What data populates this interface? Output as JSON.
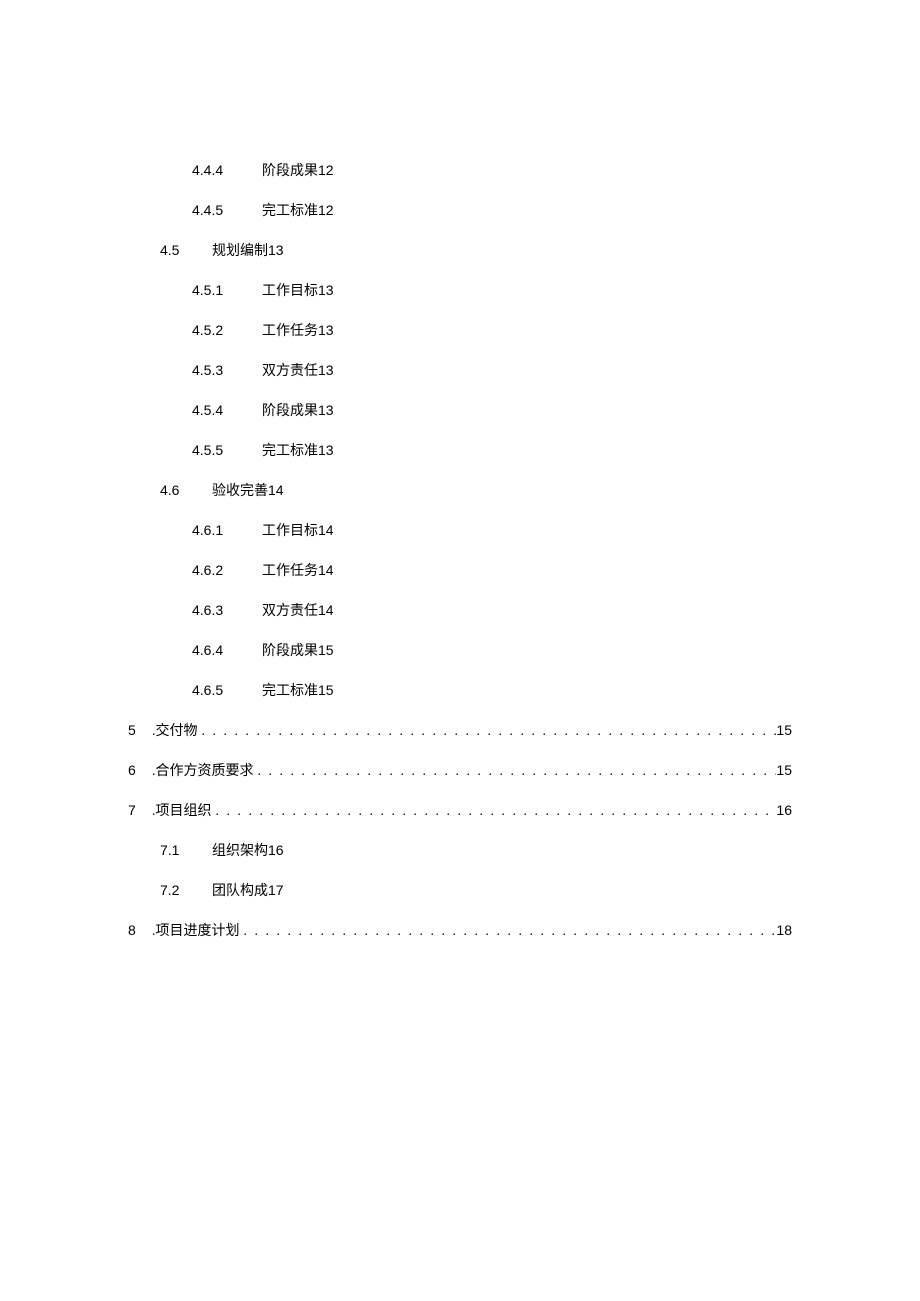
{
  "toc": {
    "items": [
      {
        "level": 3,
        "num": "4.4.4",
        "title": "阶段成果",
        "page": "12",
        "dotted": false
      },
      {
        "level": 3,
        "num": "4.4.5",
        "title": "完工标准",
        "page": "12",
        "dotted": false
      },
      {
        "level": 2,
        "num": "4.5",
        "title": "规划编制",
        "page": "13",
        "dotted": false
      },
      {
        "level": 3,
        "num": "4.5.1",
        "title": "工作目标",
        "page": "13",
        "dotted": false
      },
      {
        "level": 3,
        "num": "4.5.2",
        "title": "工作任务",
        "page": "13",
        "dotted": false
      },
      {
        "level": 3,
        "num": "4.5.3",
        "title": "双方责任",
        "page": "13",
        "dotted": false
      },
      {
        "level": 3,
        "num": "4.5.4",
        "title": "阶段成果",
        "page": "13",
        "dotted": false
      },
      {
        "level": 3,
        "num": "4.5.5",
        "title": "完工标准",
        "page": "13",
        "dotted": false
      },
      {
        "level": 2,
        "num": "4.6",
        "title": "验收完善",
        "page": "14",
        "dotted": false
      },
      {
        "level": 3,
        "num": "4.6.1",
        "title": "工作目标",
        "page": "14",
        "dotted": false
      },
      {
        "level": 3,
        "num": "4.6.2",
        "title": "工作任务",
        "page": "14",
        "dotted": false
      },
      {
        "level": 3,
        "num": "4.6.3",
        "title": "双方责任",
        "page": "14",
        "dotted": false
      },
      {
        "level": 3,
        "num": "4.6.4",
        "title": "阶段成果",
        "page": "15",
        "dotted": false
      },
      {
        "level": 3,
        "num": "4.6.5",
        "title": "完工标准",
        "page": "15",
        "dotted": false
      },
      {
        "level": 1,
        "num": "5",
        "title": "交付物",
        "page": "15",
        "dotted": true
      },
      {
        "level": 1,
        "num": "6",
        "title": "合作方资质要求",
        "page": "15",
        "dotted": true
      },
      {
        "level": 1,
        "num": "7",
        "title": "项目组织",
        "page": "16",
        "dotted": true
      },
      {
        "level": 2,
        "num": "7.1",
        "title": "组织架构",
        "page": "16",
        "dotted": false
      },
      {
        "level": 2,
        "num": "7.2",
        "title": "团队构成",
        "page": "17",
        "dotted": false
      },
      {
        "level": 1,
        "num": "8",
        "title": "项目进度计划",
        "page": "18",
        "dotted": true
      }
    ]
  },
  "dotleader": ". . . . . . . . . . . . . . . . . . . . . . . . . . . . . . . . . . . . . . . . . . . . . . . . . . . . . . . . . . . . . . . . . . . . . . . . . . . . . . . . . . . . . . . . . . . . . . . . . . . . . . . . . . . . . . . . . . . . . . . . . . ."
}
